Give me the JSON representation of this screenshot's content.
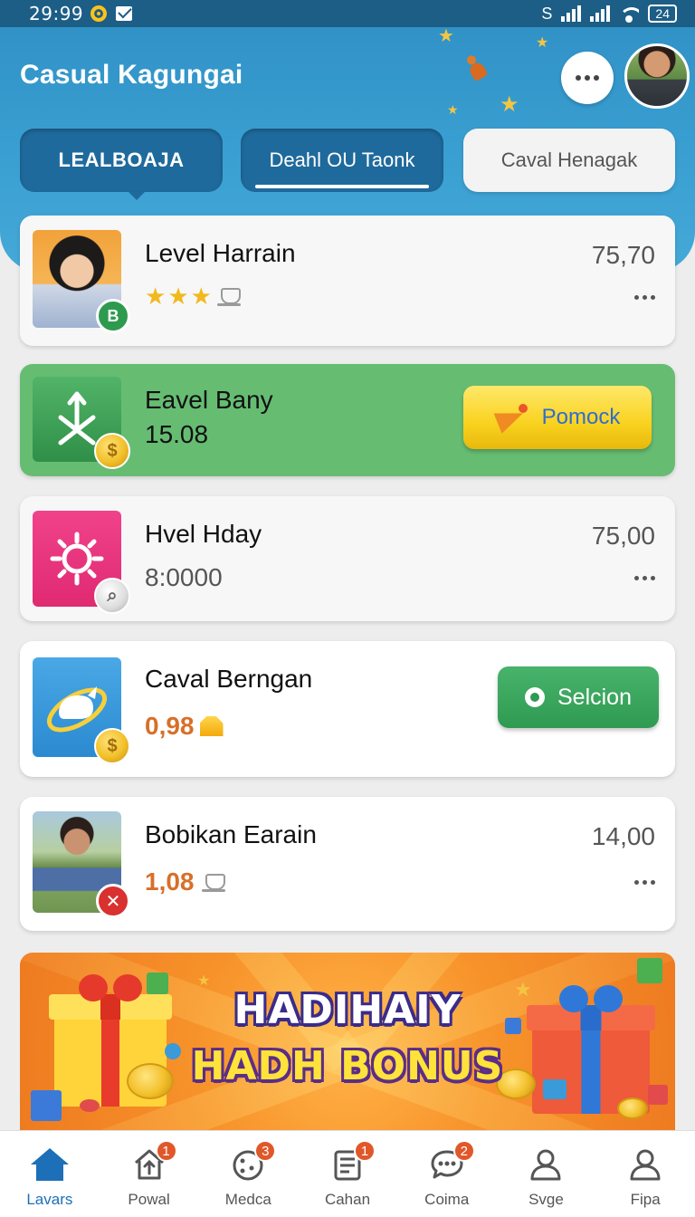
{
  "status_bar": {
    "time": "29:99",
    "battery": "24"
  },
  "header": {
    "title": "Casual Kagungai"
  },
  "tabs": [
    {
      "label": "LEALBOAJA",
      "active": true
    },
    {
      "label": "Deahl OU Taonk",
      "active": false
    },
    {
      "label": "Caval Henagak",
      "active": false
    }
  ],
  "list": {
    "item1": {
      "title": "Level Harrain",
      "amount": "75,70",
      "badge": "B",
      "stars_filled": 3
    },
    "item2": {
      "title": "Eavel Bany",
      "subtitle": "15.08",
      "button_label": "Pomock"
    },
    "item3": {
      "title": "Hvel Hday",
      "subtitle": "8:0000",
      "amount": "75,00"
    },
    "item4": {
      "title": "Caval Berngan",
      "subtitle": "0,98",
      "button_label": "Selcion"
    },
    "item5": {
      "title": "Bobikan Earain",
      "subtitle": "1,08",
      "amount": "14,00"
    }
  },
  "banner": {
    "line1": "HADIHAIY",
    "line2": "HADH BONUS"
  },
  "bottom_nav": [
    {
      "label": "Lavars",
      "icon": "home-icon",
      "active": true
    },
    {
      "label": "Powal",
      "icon": "house-upload-icon",
      "badge": "1"
    },
    {
      "label": "Medca",
      "icon": "cookie-icon",
      "badge": "3"
    },
    {
      "label": "Cahan",
      "icon": "document-icon",
      "badge": "1"
    },
    {
      "label": "Coima",
      "icon": "chat-icon",
      "badge": "2"
    },
    {
      "label": "Svge",
      "icon": "person-icon"
    },
    {
      "label": "Fipa",
      "icon": "profile-icon"
    }
  ],
  "colors": {
    "header_blue": "#3aa0d2",
    "tab_dark": "#1f6a9c",
    "card_green": "#66bd72",
    "button_yellow": "#f9d21f",
    "button_green": "#2f9a52",
    "accent_orange": "#d7702a",
    "nav_active": "#1d6fb8"
  }
}
